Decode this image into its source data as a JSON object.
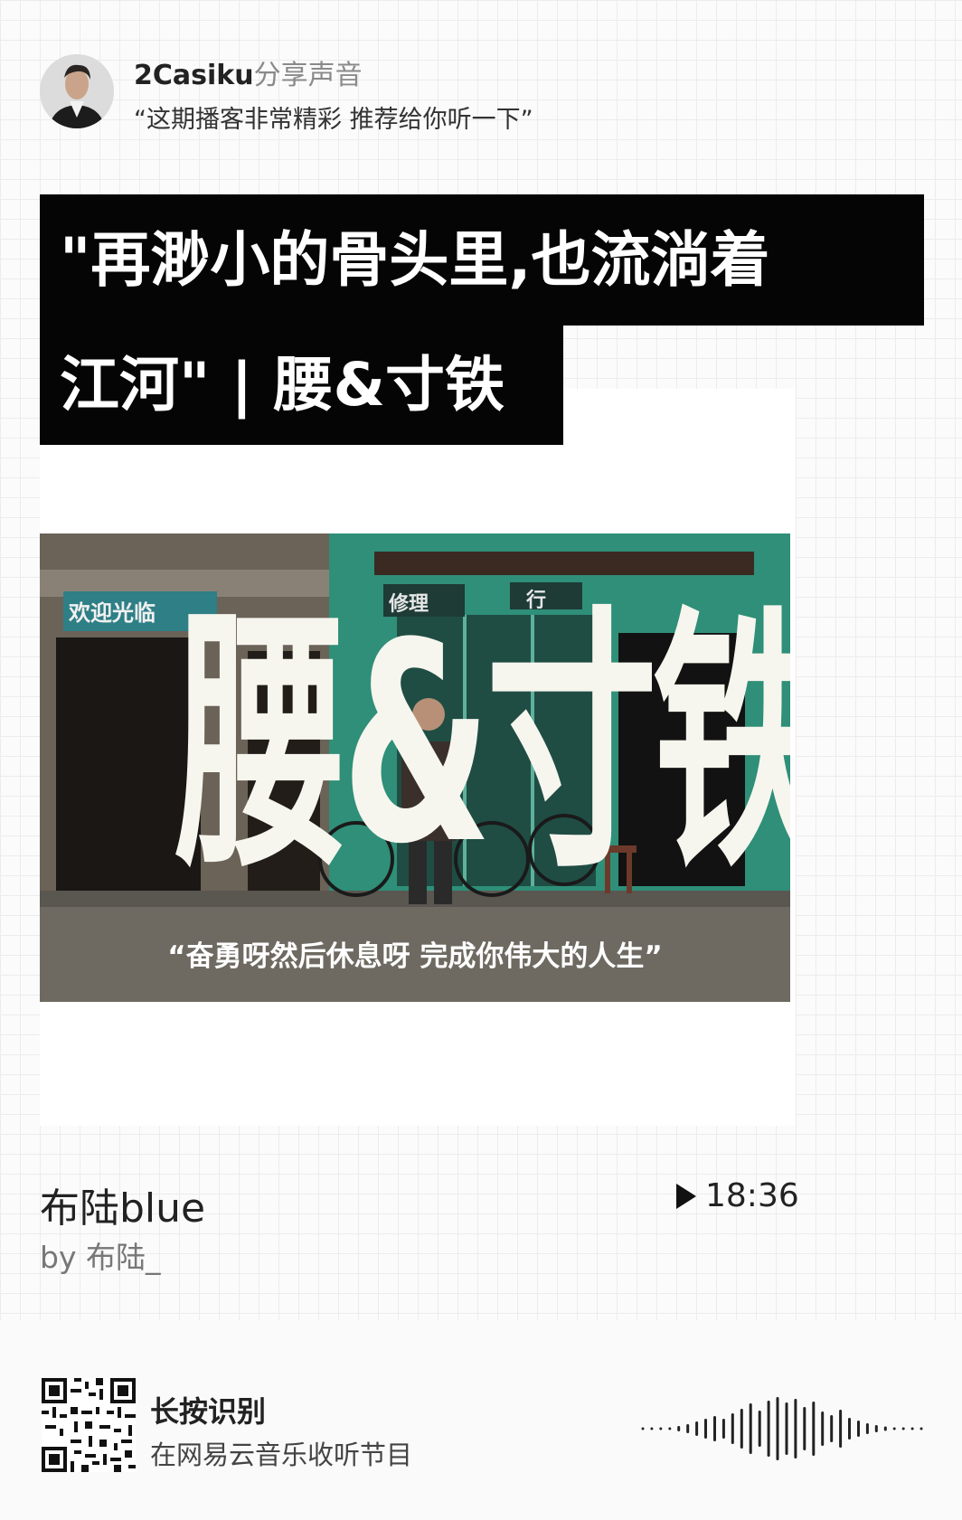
{
  "header": {
    "username": "2Casiku",
    "share_suffix": "分享声音",
    "quote": "“这期播客非常精彩 推荐给你听一下”"
  },
  "episode": {
    "title_line1": "\"再渺小的骨头里,也流淌着",
    "title_line2": "江河\" | 腰&寸铁"
  },
  "cover": {
    "headline": "腰&寸铁",
    "caption": "“奋勇呀然后休息呀 完成你伟大的人生”",
    "signs": [
      "欢迎光临",
      "修理",
      "行"
    ]
  },
  "track": {
    "title": "布陆blue",
    "author": "by 布陆_",
    "duration": "18:36"
  },
  "footer": {
    "scan_label": "长按识别",
    "scan_sub": "在网易云音乐收听节目"
  },
  "colors": {
    "title_bg": "#050505",
    "cover_wall": "#2f8f78",
    "cover_ground": "#6e6a62"
  }
}
